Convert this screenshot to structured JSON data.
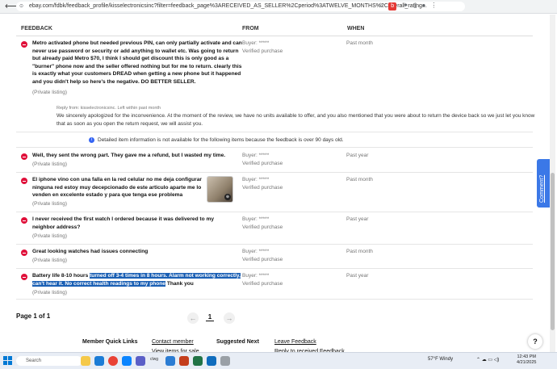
{
  "browser": {
    "url": "ebay.com/fdbk/feedback_profile/kisselectronicsinc?filter=feedback_page%3ARECEIVED_AS_SELLER%2Cperiod%3ATWELVE_MONTHS%2Coverall_rating..."
  },
  "table": {
    "col_feedback": "FEEDBACK",
    "col_from": "FROM",
    "col_when": "WHEN"
  },
  "rows": [
    {
      "text": "Metro activated phone but needed previous PIN, can only partially activate and can never use password or security or add anything to wallet etc. Was going to return but already paid Metro $70, I think I should get discount this is only good as a \"burner\" phone now and the seller offered nothing but for me to return. clearly this is exactly what your customers DREAD when getting a new phone but it happened and you didn't help so here's the negative. DO BETTER SELLER.",
      "listing": "(Private listing)",
      "buyer": "Buyer: *****",
      "verified": "Verified purchase",
      "when": "Past month",
      "reply_from": "Reply from: kisselectronicsinc. Left within past month",
      "reply": "We sincerely apologized for the inconvenience. At the moment of the review, we have no units available to offer, and you also mentioned that you were about to return the device back so we just let you know that as soon as you open the return request, we will assist you."
    },
    {
      "text": "Well, they sent the wrong part. They gave me a refund, but I wasted my time.",
      "listing": "(Private listing)",
      "buyer": "Buyer: *****",
      "verified": "Verified purchase",
      "when": "Past year"
    },
    {
      "text": "El iphone vino con una falla en la red celular no me deja configurar ninguna red estoy muy decepcionado de este articulo aparte me lo venden en excelente estado y para que tenga ese problema",
      "listing": "(Private listing)",
      "buyer": "Buyer: *****",
      "verified": "Verified purchase",
      "when": "Past month"
    },
    {
      "text": "I never received the first watch I ordered because it was delivered to my neighbor address?",
      "listing": "(Private listing)",
      "buyer": "Buyer: *****",
      "verified": "Verified purchase",
      "when": "Past year"
    },
    {
      "text": "Great looking watches had issues connecting",
      "listing": "(Private listing)",
      "buyer": "Buyer: *****",
      "verified": "Verified purchase",
      "when": "Past month"
    },
    {
      "text_before": "Battery life 8-10 hours ",
      "text_highlight": "turned off 3-4 times in 8 hours. Alarm not working correctly, can't hear it. No correct health readings to my phone",
      "text_after": " Thank you",
      "listing": "(Private listing)",
      "buyer": "Buyer: *****",
      "verified": "Verified purchase",
      "when": "Past year"
    }
  ],
  "info_notice": "Detailed item information is not available for the following items because the feedback is over 90 days old.",
  "pagination": {
    "summary": "Page 1 of 1",
    "current": "1"
  },
  "footer": {
    "member_title": "Member Quick Links",
    "link1": "Contact member",
    "link2": "View items for sale",
    "suggested_title": "Suggested Next",
    "link3": "Leave Feedback",
    "link4": "Reply to received Feedback"
  },
  "help": "?",
  "comment_tab": "Comment?",
  "taskbar": {
    "search": "Search",
    "app_label": "clwg",
    "weather": "57°F  Windy",
    "time": "12:43 PM",
    "date": "4/21/2025"
  },
  "colors": {
    "negative": "#e0103a",
    "highlight": "#1a5fb4",
    "comment_tab": "#3b78e7",
    "info": "#3665f3"
  }
}
